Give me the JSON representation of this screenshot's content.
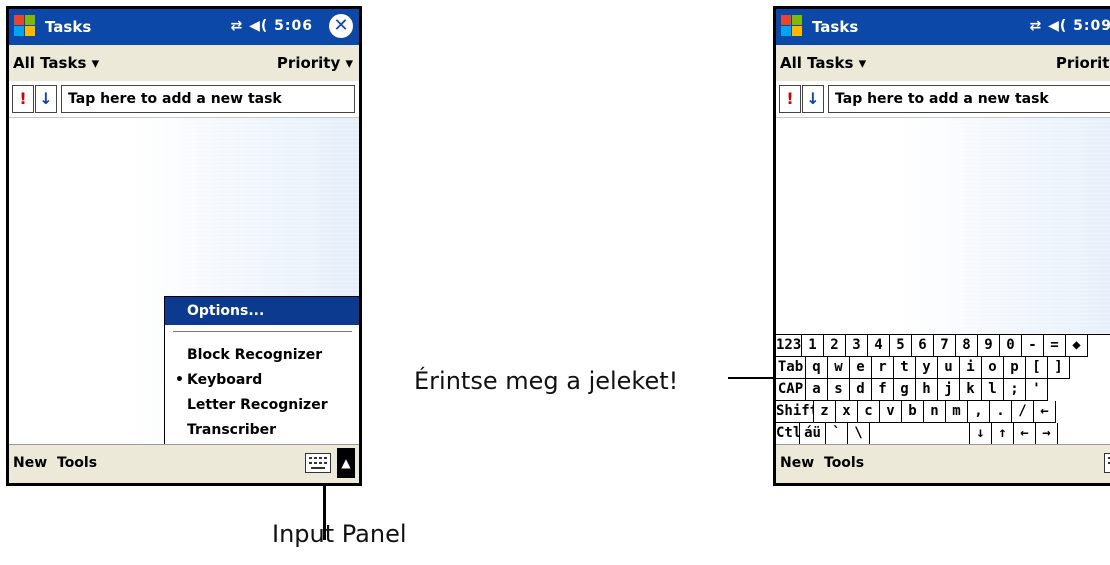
{
  "screens": [
    {
      "title": "Tasks",
      "time": "5:06",
      "status_icons": "⇄ ◀(",
      "filter": "All Tasks ▾",
      "sort": "Priority ▾",
      "priority_btn": "!",
      "sort_btn": "↓",
      "new_task_placeholder": "Tap here to add a new task",
      "menu_new": "New",
      "menu_tools": "Tools",
      "input_menu": {
        "options": "Options...",
        "items": [
          "Block Recognizer",
          "Keyboard",
          "Letter Recognizer",
          "Transcriber"
        ],
        "selected_bullet": "•"
      }
    },
    {
      "title": "Tasks",
      "time": "5:09",
      "status_icons": "⇄ ◀(",
      "filter": "All Tasks ▾",
      "sort": "Priority ▾",
      "priority_btn": "!",
      "sort_btn": "↓",
      "new_task_placeholder": "Tap here to add a new task",
      "menu_new": "New",
      "menu_tools": "Tools",
      "keyboard": {
        "rows": [
          [
            "123",
            "1",
            "2",
            "3",
            "4",
            "5",
            "6",
            "7",
            "8",
            "9",
            "0",
            "-",
            "=",
            "◆"
          ],
          [
            "Tab",
            "q",
            "w",
            "e",
            "r",
            "t",
            "y",
            "u",
            "i",
            "o",
            "p",
            "[",
            "]"
          ],
          [
            "CAP",
            "a",
            "s",
            "d",
            "f",
            "g",
            "h",
            "j",
            "k",
            "l",
            ";",
            "'"
          ],
          [
            "Shift",
            "z",
            "x",
            "c",
            "v",
            "b",
            "n",
            "m",
            ",",
            ".",
            "/",
            "←"
          ],
          [
            "Ctl",
            "áü",
            "`",
            "\\",
            " ",
            "↓",
            "↑",
            "←",
            "→"
          ]
        ]
      }
    }
  ],
  "callouts": {
    "input_panel": "Input Panel",
    "keys": "Érintse meg a jeleket!"
  },
  "colors": {
    "title_bar": "#0b48a8",
    "menu_highlight": "#0b3a8f",
    "bar_bg": "#ece9d8",
    "priority_red": "#d40000"
  }
}
